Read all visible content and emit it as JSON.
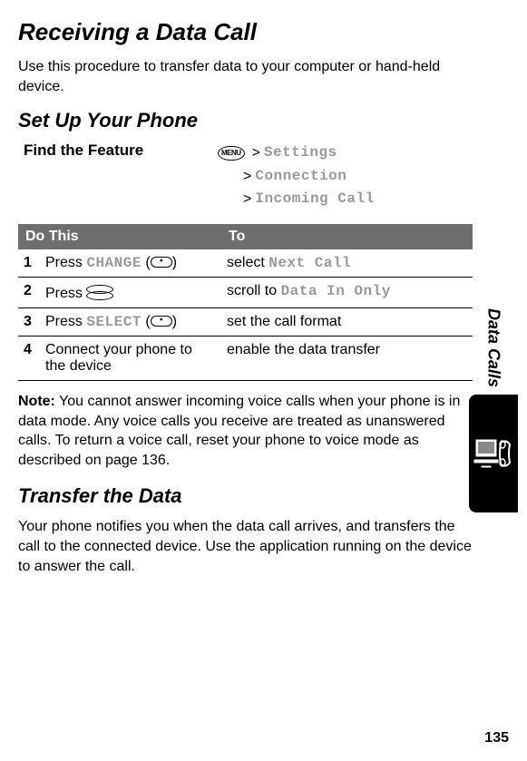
{
  "title": "Receiving a Data Call",
  "intro": "Use this procedure to transfer data to your computer or hand-held device.",
  "setup_heading": "Set Up Your Phone",
  "find_feature_label": "Find the Feature",
  "menu": {
    "menu_key": "MENU",
    "l1": "Settings",
    "l2": "Connection",
    "l3": "Incoming Call"
  },
  "table": {
    "h1": "Do This",
    "h2": "To",
    "rows": [
      {
        "n": "1",
        "do_pre": "Press ",
        "do_lcd": "CHANGE",
        "do_post": " (",
        "to_pre": "select ",
        "to_lcd": "Next Call"
      },
      {
        "n": "2",
        "do_pre": "Press ",
        "to_pre": "scroll to ",
        "to_lcd": "Data In Only"
      },
      {
        "n": "3",
        "do_pre": "Press ",
        "do_lcd": "SELECT",
        "do_post": " (",
        "to": "set the call format"
      },
      {
        "n": "4",
        "do": "Connect your phone to the device",
        "to": "enable the data transfer"
      }
    ]
  },
  "note_label": "Note:",
  "note_body": " You cannot answer incoming voice calls when your phone is in data mode. Any voice calls you receive are treated as unanswered calls. To return a voice call, reset your phone to voice mode as described on page 136.",
  "transfer_heading": "Transfer the Data",
  "transfer_body": "Your phone notifies you when the data call arrives, and transfers the call to the connected device. Use the application running on the device to answer the call.",
  "side_label": "Data Calls",
  "page_number": "135"
}
